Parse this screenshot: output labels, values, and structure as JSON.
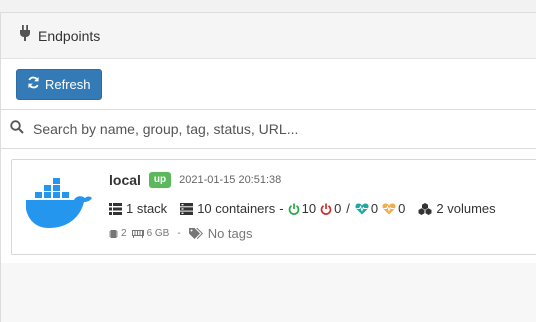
{
  "header": {
    "title": "Endpoints",
    "icon": "plug-icon"
  },
  "toolbar": {
    "refresh_label": "Refresh",
    "refresh_icon": "refresh-icon"
  },
  "search": {
    "placeholder": "Search by name, group, tag, status, URL..."
  },
  "endpoint": {
    "name": "local",
    "status": "up",
    "timestamp": "2021-01-15 20:51:38",
    "stacks": "1 stack",
    "containers": "10 containers",
    "dash": "-",
    "running": "10",
    "stopped": "0",
    "slash": "/",
    "healthy": "0",
    "unhealthy": "0",
    "volumes": "2 volumes",
    "cpu": "2",
    "memory": "6 GB",
    "dash2": "-",
    "tags": "No tags"
  },
  "colors": {
    "primary": "#337ab7",
    "success": "#5cb85c",
    "running": "#28a745",
    "stopped": "#c9302c",
    "healthy": "#20a8a0",
    "unhealthy": "#f0ad4e",
    "docker": "#2496ed"
  }
}
